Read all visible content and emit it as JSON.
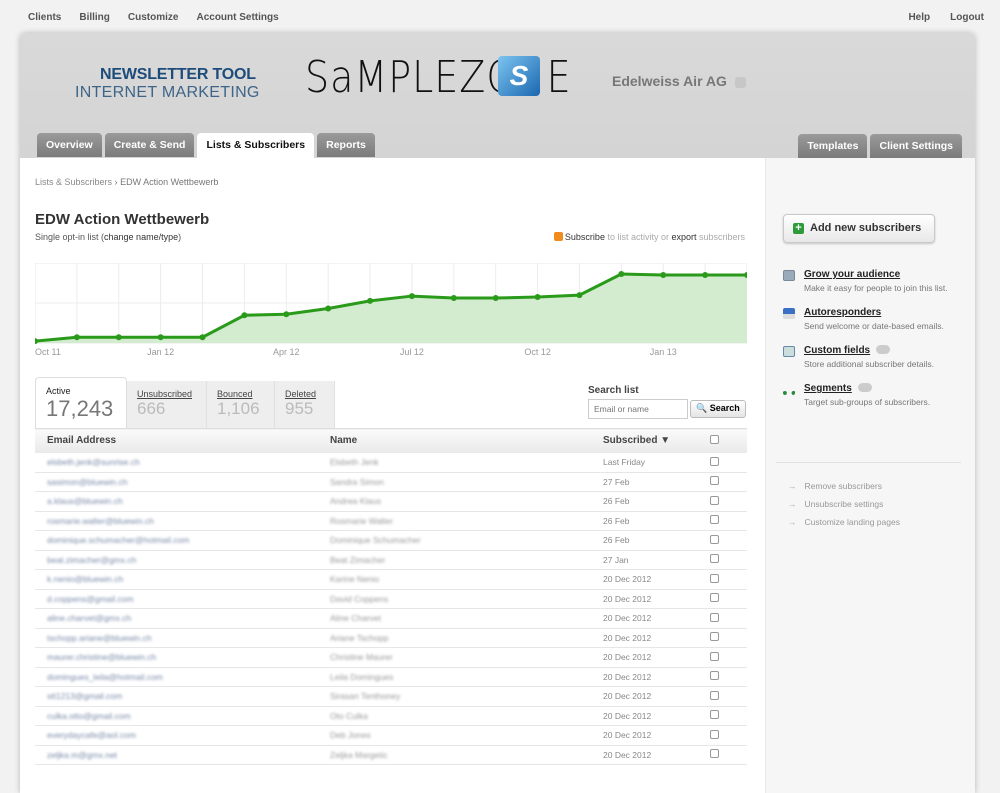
{
  "topnav": {
    "left": [
      "Clients",
      "Billing",
      "Customize",
      "Account Settings"
    ],
    "right": [
      "Help",
      "Logout"
    ]
  },
  "header": {
    "tool_line1": "NEWSLETTER TOOL",
    "tool_line2": "INTERNET MARKETING",
    "logo_text": "SaMPLEZONE",
    "logo_mark": "S",
    "client_name": "Edelweiss Air AG"
  },
  "tabs_left": [
    "Overview",
    "Create & Send",
    "Lists & Subscribers",
    "Reports"
  ],
  "active_tab": "Lists & Subscribers",
  "tabs_right": [
    "Templates",
    "Client Settings"
  ],
  "breadcrumb": {
    "parent": "Lists & Subscribers",
    "sep": "›",
    "current": "EDW Action Wettbewerb"
  },
  "list": {
    "title": "EDW Action Wettbewerb",
    "type_prefix": "Single opt-in list (",
    "change_link": "change name/type",
    "type_suffix": ")",
    "subscribe_link": "Subscribe",
    "mid_text": " to list activity or ",
    "export_link": "export",
    "end_text": " subscribers"
  },
  "chart_data": {
    "type": "area",
    "x": [
      "Oct 11",
      "Nov 11",
      "Dec 11",
      "Jan 12",
      "Feb 12",
      "Mar 12",
      "Apr 12",
      "May 12",
      "Jun 12",
      "Jul 12",
      "Aug 12",
      "Sep 12",
      "Oct 12",
      "Nov 12",
      "Dec 12",
      "Jan 13",
      "Feb 13",
      "Mar 13"
    ],
    "values": [
      480,
      1460,
      1460,
      1460,
      1460,
      7040,
      7290,
      8740,
      10690,
      11900,
      11410,
      11410,
      11660,
      12140,
      17490,
      17240,
      17240,
      17240
    ],
    "tick_labels": [
      "Oct 11",
      "Jan 12",
      "Apr 12",
      "Jul 12",
      "Oct 12",
      "Jan 13"
    ],
    "grid": true,
    "line_color": "#2a9a1a",
    "fill_color": "#d3ecd0"
  },
  "stats": [
    {
      "label": "Active",
      "value": "17,243"
    },
    {
      "label": "Unsubscribed",
      "value": "666"
    },
    {
      "label": "Bounced",
      "value": "1,106"
    },
    {
      "label": "Deleted",
      "value": "955"
    }
  ],
  "search": {
    "label": "Search list",
    "placeholder": "Email or name",
    "button": "Search"
  },
  "table": {
    "columns": [
      "Email Address",
      "Name",
      "Subscribed ▼"
    ],
    "rows": [
      [
        "elsbeth.jenk@sunrise.ch",
        "Elsbeth Jenk",
        "Last Friday"
      ],
      [
        "sasimon@bluewin.ch",
        "Sandra Simon",
        "27 Feb"
      ],
      [
        "a.klaus@bluewin.ch",
        "Andrea Klaus",
        "26 Feb"
      ],
      [
        "rosmarie.walter@bluewin.ch",
        "Rosmarie Walter",
        "26 Feb"
      ],
      [
        "dominique.schumacher@hotmail.com",
        "Dominique Schumacher",
        "26 Feb"
      ],
      [
        "beat.zimacher@gmx.ch",
        "Beat Zimacher",
        "27 Jan"
      ],
      [
        "k.nenio@bluewin.ch",
        "Karine Nenio",
        "20 Dec 2012"
      ],
      [
        "d.coppens@gmail.com",
        "David Coppens",
        "20 Dec 2012"
      ],
      [
        "aline.charvet@gmx.ch",
        "Aline Charvet",
        "20 Dec 2012"
      ],
      [
        "tschopp.ariane@bluewin.ch",
        "Ariane Tschopp",
        "20 Dec 2012"
      ],
      [
        "maurer.christine@bluewin.ch",
        "Christine Maurer",
        "20 Dec 2012"
      ],
      [
        "domingues_leila@hotmail.com",
        "Leila Domingues",
        "20 Dec 2012"
      ],
      [
        "stt1213@gmail.com",
        "Sirasan Tenthoney",
        "20 Dec 2012"
      ],
      [
        "culka.otto@gmail.com",
        "Oto Culka",
        "20 Dec 2012"
      ],
      [
        "everydaycafe@aol.com",
        "Deb Jones",
        "20 Dec 2012"
      ],
      [
        "zeljka.m@gmx.net",
        "Zeljka Margetic",
        "20 Dec 2012"
      ]
    ]
  },
  "sidebar": {
    "add_button": "Add new subscribers",
    "features": [
      {
        "title": "Grow your audience",
        "desc": "Make it easy for people to join this list.",
        "icon": "form-icon"
      },
      {
        "title": "Autoresponders",
        "desc": "Send welcome or date-based emails.",
        "icon": "calendar-icon"
      },
      {
        "title": "Custom fields",
        "desc": "Store additional subscriber details.",
        "icon": "contact-card-icon"
      },
      {
        "title": "Segments",
        "desc": "Target sub-groups of subscribers.",
        "icon": "hierarchy-icon"
      }
    ],
    "links": [
      "Remove subscribers",
      "Unsubscribe settings",
      "Customize landing pages"
    ]
  }
}
